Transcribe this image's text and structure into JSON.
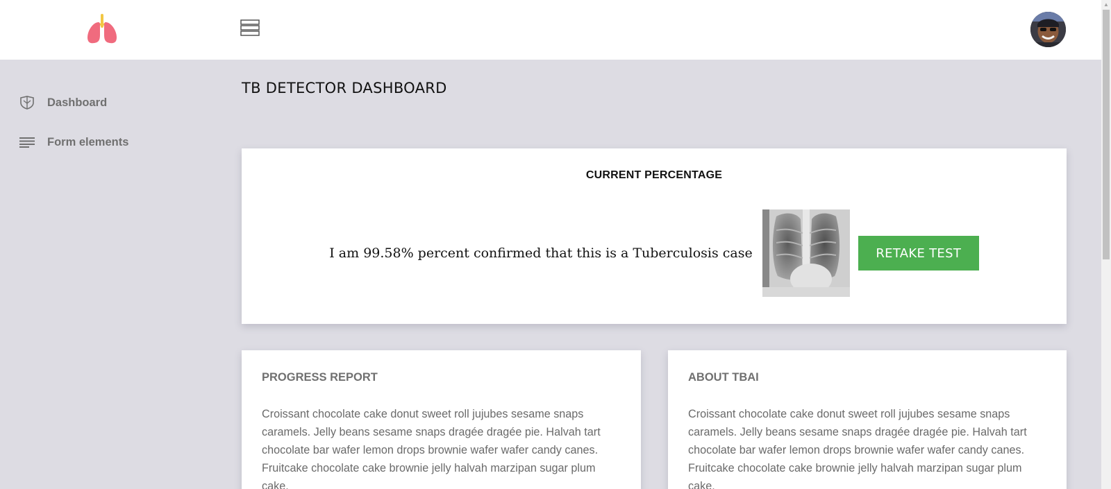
{
  "header": {
    "logo_icon": "lungs-icon",
    "menu_icon": "menu-stack-icon",
    "avatar_icon": "user-avatar"
  },
  "sidebar": {
    "items": [
      {
        "label": "Dashboard",
        "icon": "shield-icon"
      },
      {
        "label": "Form elements",
        "icon": "lines-icon"
      }
    ]
  },
  "page": {
    "title": "TB DETECTOR DASHBOARD"
  },
  "result_card": {
    "title": "CURRENT PERCENTAGE",
    "message_prefix": "I am ",
    "percentage": "99.58%",
    "message_suffix": " percent confirmed that this is a Tuberculosis case",
    "image_icon": "chest-xray-image",
    "retake_label": "RETAKE TEST",
    "button_color": "#4caf50"
  },
  "progress_card": {
    "title": "PROGRESS REPORT",
    "body": "Croissant chocolate cake donut sweet roll jujubes sesame snaps caramels. Jelly beans sesame snaps dragée dragée pie. Halvah tart chocolate bar wafer lemon drops brownie wafer wafer candy canes. Fruitcake chocolate cake brownie jelly halvah marzipan sugar plum cake."
  },
  "about_card": {
    "title": "ABOUT TBAI",
    "body": "Croissant chocolate cake donut sweet roll jujubes sesame snaps caramels. Jelly beans sesame snaps dragée dragée pie. Halvah tart chocolate bar wafer lemon drops brownie wafer wafer candy canes. Fruitcake chocolate cake brownie jelly halvah marzipan sugar plum cake."
  },
  "colors": {
    "background": "#dddce3",
    "header": "#ffffff",
    "accent_green": "#4caf50",
    "logo_pink": "#f06b7e"
  }
}
